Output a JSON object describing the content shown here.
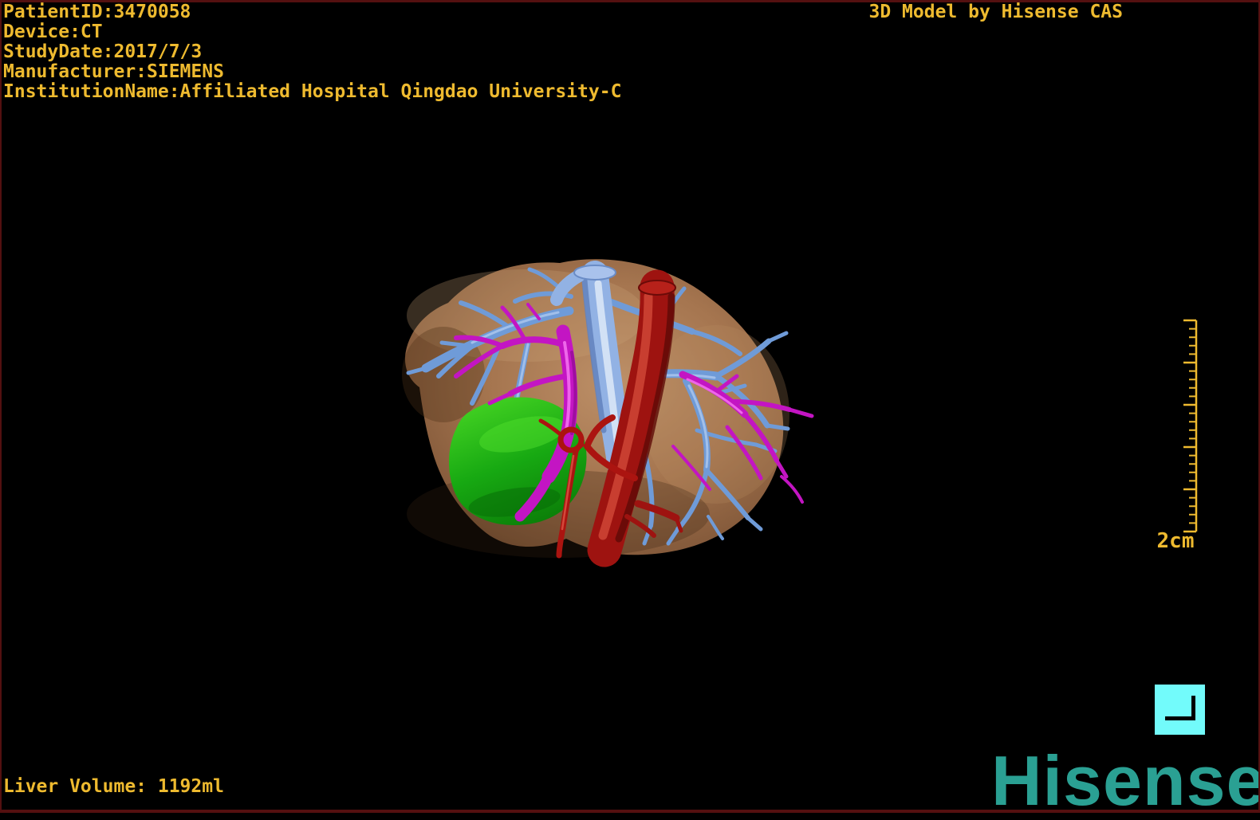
{
  "overlay": {
    "patient_id": "PatientID:3470058",
    "device": "Device:CT",
    "study_date": "StudyDate:2017/7/3",
    "manufacturer": "Manufacturer:SIEMENS",
    "institution": "InstitutionName:Affiliated Hospital Qingdao University-C",
    "watermark": "3D Model by Hisense CAS",
    "liver_volume": "Liver Volume: 1192ml"
  },
  "scale_bar": {
    "label": "2cm"
  },
  "branding": {
    "logo_text": "Hisense"
  },
  "icons": {
    "corner_mark": "corner-bracket-icon"
  },
  "colors": {
    "overlay_text": "#eeba2f",
    "logo_teal": "#2aa093",
    "icon_cyan": "#72fbfb",
    "frame_border": "#541010",
    "liver": "#a97b57",
    "gallbladder": "#16aa10",
    "aorta": "#9e1310",
    "vena_cava": "#92b2e4",
    "portal_vein": "#c315c3",
    "hepatic_vein": "#6f9bd8",
    "hepatic_artery": "#ab1410"
  },
  "model": {
    "structures": [
      {
        "name": "liver",
        "color": "#a97b57"
      },
      {
        "name": "gallbladder",
        "color": "#16aa10"
      },
      {
        "name": "aorta",
        "color": "#9e1310"
      },
      {
        "name": "inferior-vena-cava",
        "color": "#92b2e4"
      },
      {
        "name": "portal-vein",
        "color": "#c315c3"
      },
      {
        "name": "hepatic-veins",
        "color": "#6f9bd8"
      },
      {
        "name": "hepatic-artery",
        "color": "#ab1410"
      }
    ]
  }
}
